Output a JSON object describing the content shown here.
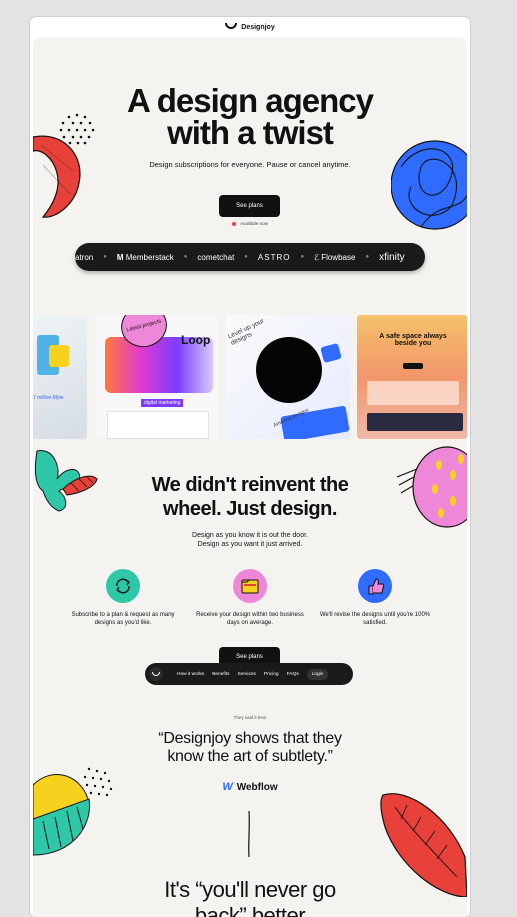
{
  "browser": {
    "brand": "Designjoy"
  },
  "hero": {
    "title_line1": "A design agency",
    "title_line2": "with a twist",
    "subtitle": "Design subscriptions for everyone. Pause or cancel anytime.",
    "cta_label": "See plans",
    "availability": "Available now"
  },
  "logos": [
    "atron",
    "Memberstack",
    "cometchat",
    "ASTRO",
    "Flowbase",
    "xfinity"
  ],
  "cards": {
    "badge": "Latest projects",
    "card2_heading": "Loop",
    "card2_tag": "digital marketing",
    "card3_text": "Level up your designs",
    "card3_footer": "Amazing designs",
    "card4_heading": "A safe space always beside you",
    "card1_text": "7 million Myte"
  },
  "section": {
    "title_line1": "We didn't reinvent the",
    "title_line2": "wheel. Just design.",
    "sub_line1": "Design as you know it is out the door.",
    "sub_line2": "Design as you want it just arrived."
  },
  "features": [
    {
      "icon": "refresh-icon",
      "text": "Subscribe to a plan & request as many designs as you'd like."
    },
    {
      "icon": "folder-icon",
      "text": "Receive your design within two business days on average."
    },
    {
      "icon": "thumbs-up-icon",
      "text": "We'll revise the designs until you're 100% satisfied."
    }
  ],
  "nav": {
    "see_plans": "See plans",
    "items": [
      "How it works",
      "Benefits",
      "Services",
      "Pricing",
      "FAQs"
    ],
    "login": "Login"
  },
  "testimonial": {
    "kicker": "They said it best",
    "quote_line1": "“Designjoy shows that they",
    "quote_line2": "know the art of subtlety.”",
    "company": "Webflow"
  },
  "bottom": {
    "title_line1": "It's “you'll never go",
    "title_line2": "back” better"
  },
  "colors": {
    "page_bg": "#f5f3ef",
    "dark": "#1a1a1a",
    "accent_red": "#e7413a",
    "blue": "#2f6bff",
    "teal": "#2ec7a7",
    "pink": "#ee87d7",
    "yellow": "#f6d21e"
  }
}
